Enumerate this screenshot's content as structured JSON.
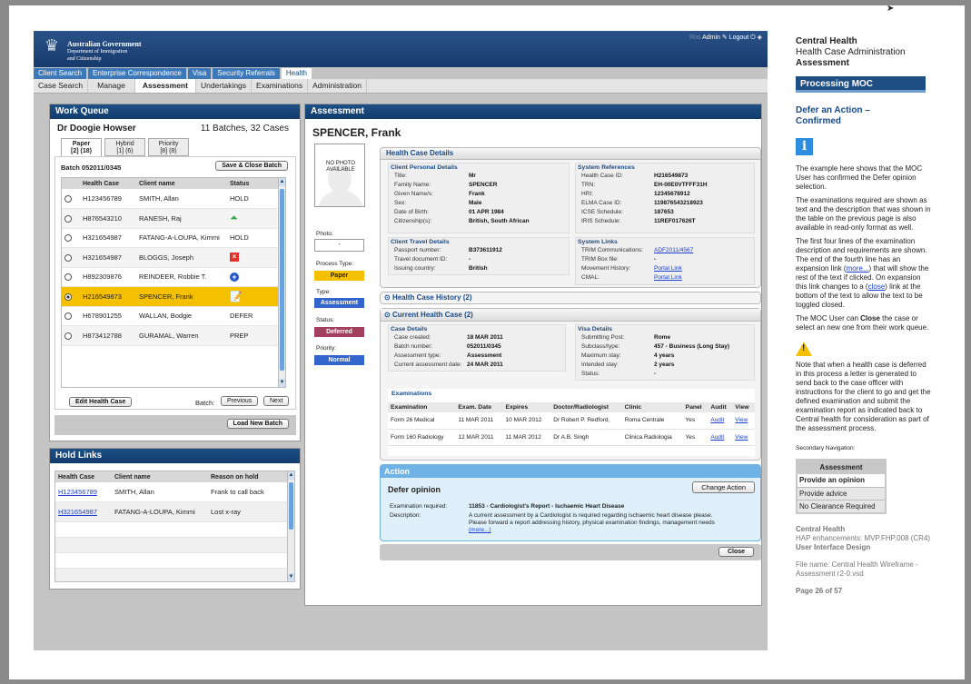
{
  "app": {
    "org_line1": "Australian Government",
    "org_line2": "Department of Immigration",
    "org_line3": "and Citizenship",
    "userlinks": {
      "prefix": "Ros",
      "admin": "Admin",
      "logout": "Logout"
    },
    "top_tabs": [
      "Client Search",
      "Enterprise Correspondence",
      "Visa",
      "Security Referrals",
      "Health"
    ],
    "sub_tabs": [
      "Case Search",
      "Manage",
      "Assessment",
      "Undertakings",
      "Examinations",
      "Administration"
    ]
  },
  "work_queue": {
    "title": "Work Queue",
    "doctor": "Dr Doogie Howser",
    "batches": "11 Batches, 32 Cases",
    "tabs": [
      {
        "l1": "Paper",
        "l2": "[2] (18)"
      },
      {
        "l1": "Hybrid",
        "l2": "[1] (6)"
      },
      {
        "l1": "Priority",
        "l2": "[8] (8)"
      }
    ],
    "batch_label": "Batch 052011/0345",
    "save_close": "Save & Close Batch",
    "columns": [
      "Health Case",
      "Client name",
      "Status"
    ],
    "rows": [
      {
        "case": "H123456789",
        "name": "SMITH, Allan",
        "status": "HOLD"
      },
      {
        "case": "H876543210",
        "name": "RANESH, Raj",
        "status": ""
      },
      {
        "case": "H321654987",
        "name": "FATANG-A-LOUPA, Kimmi",
        "status": "HOLD"
      },
      {
        "case": "H321654987",
        "name": "BLOGGS, Joseph",
        "status": ""
      },
      {
        "case": "H892309876",
        "name": "REINDEER, Robbie T.",
        "status": ""
      },
      {
        "case": "H216549873",
        "name": "SPENCER, Frank",
        "status": ""
      },
      {
        "case": "H678901255",
        "name": "WALLAN, Bodgie",
        "status": "DEFER"
      },
      {
        "case": "H873412788",
        "name": "GURAMAL, Warren",
        "status": "PREP"
      }
    ],
    "edit_btn": "Edit Health Case",
    "batch_nav": "Batch:",
    "prev": "Previous",
    "next": "Next",
    "load": "Load New Batch"
  },
  "hold_links": {
    "title": "Hold Links",
    "columns": [
      "Health Case",
      "Client name",
      "Reason on hold"
    ],
    "rows": [
      {
        "case": "H123456789",
        "name": "SMITH, Allan",
        "reason": "Frank to call back"
      },
      {
        "case": "H321654987",
        "name": "FATANG-A-LOUPA, Kimmi",
        "reason": "Lost x-ray"
      }
    ]
  },
  "assessment": {
    "title": "Assessment",
    "client": "SPENCER, Frank",
    "no_photo": "NO PHOTO AVAILABLE",
    "photo_label": "Photo:",
    "photo_value": "-",
    "process_label": "Process Type:",
    "process": "Paper",
    "type_label": "Type:",
    "type": "Assessment",
    "status_label": "Status:",
    "status": "Deferred",
    "priority_label": "Priority:",
    "priority": "Normal",
    "hcd_title": "Health Case Details",
    "personal": {
      "title": "Client Personal Details",
      "rows": [
        [
          "Title:",
          "Mr"
        ],
        [
          "Family Name:",
          "SPENCER"
        ],
        [
          "Given Name/s:",
          "Frank"
        ],
        [
          "Sex:",
          "Male"
        ],
        [
          "Date of Birth:",
          "01 APR 1984"
        ],
        [
          "Citizenship(s):",
          "British, South African"
        ]
      ]
    },
    "sysref": {
      "title": "System References",
      "rows": [
        [
          "Health Case ID:",
          "H216549873"
        ],
        [
          "TRN:",
          "EH-00E0VTFFF31H"
        ],
        [
          "HRI:",
          "12345678912"
        ],
        [
          "ELMA Case ID:",
          "119876543218923"
        ],
        [
          "ICSE Schedule:",
          "187653"
        ],
        [
          "IRIS Schedule:",
          "11REF017626T"
        ]
      ]
    },
    "travel": {
      "title": "Client Travel Details",
      "rows": [
        [
          "Passport number:",
          "B373611912"
        ],
        [
          "Travel document ID:",
          "-"
        ],
        [
          "Issuing country:",
          "British"
        ]
      ]
    },
    "syslinks": {
      "title": "System Links",
      "rows": [
        [
          "TRIM Communications:",
          "ADF2011/4567"
        ],
        [
          "TRIM Box file:",
          "-"
        ],
        [
          "Movement History:",
          "Portal Link"
        ],
        [
          "CMAL:",
          "Portal Link"
        ]
      ]
    },
    "history": "Health Case History (2)",
    "current": "Current Health Case (2)",
    "case_details": {
      "title": "Case Details",
      "rows": [
        [
          "Case created:",
          "18 MAR 2011"
        ],
        [
          "Batch number:",
          "052011/0345"
        ],
        [
          "Assessment type:",
          "Assessment"
        ],
        [
          "Current assessment date:",
          "24 MAR 2011"
        ]
      ]
    },
    "visa_details": {
      "title": "Visa Details",
      "rows": [
        [
          "Submitting Post:",
          "Rome"
        ],
        [
          "Subclass/type:",
          "457 - Business (Long Stay)"
        ],
        [
          "Maximum stay:",
          "4 years"
        ],
        [
          "Intended stay:",
          "2 years"
        ],
        [
          "Status:",
          "-"
        ]
      ]
    },
    "exam_title": "Examinations",
    "exam_cols": [
      "Examination",
      "Exam. Date",
      "Expires",
      "Doctor/Radiologist",
      "Clinic",
      "Panel",
      "Audit",
      "View"
    ],
    "exam_rows": [
      [
        "Form 26 Medical",
        "11 MAR 2011",
        "10 MAR 2012",
        "Dr Robert P. Redford,",
        "Roma Centrale",
        "Yes",
        "Audit",
        "View"
      ],
      [
        "Form 160 Radiology",
        "12 MAR 2011",
        "11 MAR 2012",
        "Dr A.B. Singh",
        "Clinica Radiologia",
        "Yes",
        "Audit",
        "View"
      ]
    ],
    "action_title": "Action",
    "defer_title": "Defer opinion",
    "change_action": "Change Action",
    "exam_req_label": "Examination required:",
    "exam_req": "11853 - Cardiologist's Report - Ischaemic Heart Disease",
    "desc_label": "Description:",
    "desc1": "A current assessment by a Cardiologist is required regarding ischaemic heart disease please.",
    "desc2": "Please forward a report addressing history, physical examination findings, management needs",
    "more": "(more...)",
    "close": "Close"
  },
  "doc": {
    "h1": "Central Health",
    "h2": "Health Case Administration",
    "h3": "Assessment",
    "banner": "Processing MOC",
    "subtitle": "Defer an Action – Confirmed",
    "p1": "The example here shows that the MOC User has confirmed the Defer opinion selection.",
    "p2": "The examinations required are shown as text and the description that was shown in the table on the previous page is also available in read-only format as well.",
    "p3a": "The first four lines of the examination description and requirements are shown. The end of the fourth line has an expansion link (",
    "p3link1": "more...",
    "p3b": ") that will show the rest of the text if clicked. On expansion this link changes to a (",
    "p3link2": "close",
    "p3c": ") link at the bottom of the text to allow the text to be toggled closed.",
    "p4a": "The MOC User can ",
    "p4b": "Close",
    "p4c": " the case or select an new one from their work queue.",
    "p5": "Note that when a health case is deferred in this process a letter is generated to send back to the case officer with instructions for the client to go and get the defined examination and submit the examination report as indicated back to Central health for consideration as part of the assessment process.",
    "secnav": "Secondary Navigation:",
    "nav": [
      "Assessment",
      "Provide an opinion",
      "Provide advice",
      "No Clearance Required"
    ],
    "f1": "Central Health",
    "f2": "HAP enhancements: MVP.FHP.008 (CR4)",
    "f3": "User Interface Design",
    "f4": "File name: Central Health Wireframe - Assessment r2-0.vsd",
    "page": "Page 26 of 57"
  },
  "colors": {
    "navy": "#173a6c",
    "highlight": "#f4c000",
    "paper": "#f4c000",
    "assessment": "#3366cc",
    "deferred": "#a24060",
    "normal": "#3366cc",
    "action": "#6fb2e6"
  }
}
